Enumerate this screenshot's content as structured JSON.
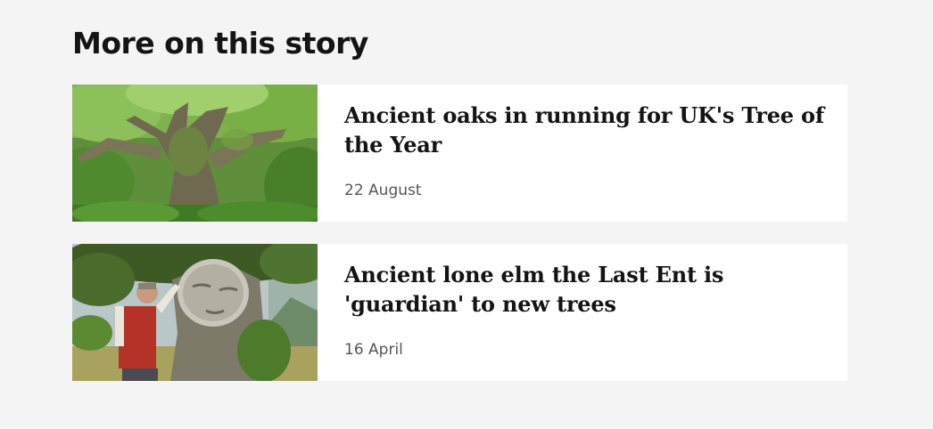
{
  "section": {
    "title": "More on this story"
  },
  "stories": [
    {
      "headline": "Ancient oaks in running for UK's Tree of the Year",
      "date": "22 August",
      "image": "ancient-oak-tree-photo"
    },
    {
      "headline": "Ancient lone elm the Last Ent is 'guardian' to new trees",
      "date": "16 April",
      "image": "man-beside-carved-face-elm-photo"
    }
  ]
}
